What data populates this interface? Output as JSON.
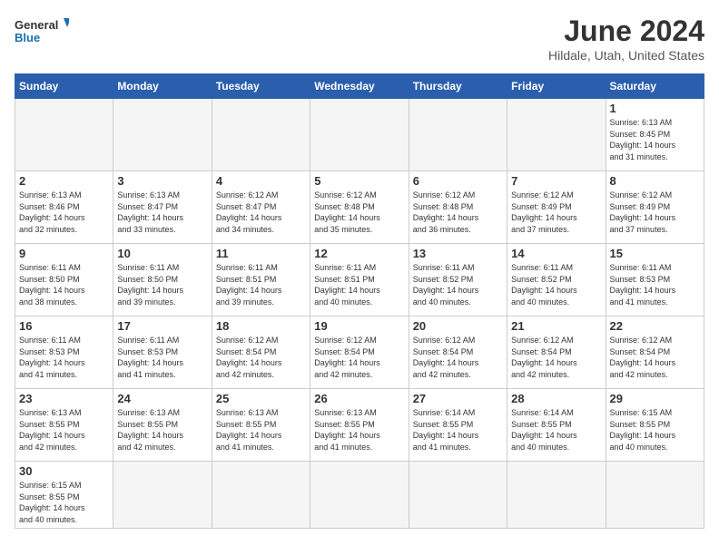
{
  "header": {
    "logo_general": "General",
    "logo_blue": "Blue",
    "month_title": "June 2024",
    "location": "Hildale, Utah, United States"
  },
  "days_of_week": [
    "Sunday",
    "Monday",
    "Tuesday",
    "Wednesday",
    "Thursday",
    "Friday",
    "Saturday"
  ],
  "weeks": [
    [
      {
        "day": "",
        "info": ""
      },
      {
        "day": "",
        "info": ""
      },
      {
        "day": "",
        "info": ""
      },
      {
        "day": "",
        "info": ""
      },
      {
        "day": "",
        "info": ""
      },
      {
        "day": "",
        "info": ""
      },
      {
        "day": "1",
        "info": "Sunrise: 6:13 AM\nSunset: 8:45 PM\nDaylight: 14 hours\nand 31 minutes."
      }
    ],
    [
      {
        "day": "2",
        "info": "Sunrise: 6:13 AM\nSunset: 8:46 PM\nDaylight: 14 hours\nand 32 minutes."
      },
      {
        "day": "3",
        "info": "Sunrise: 6:13 AM\nSunset: 8:47 PM\nDaylight: 14 hours\nand 33 minutes."
      },
      {
        "day": "4",
        "info": "Sunrise: 6:12 AM\nSunset: 8:47 PM\nDaylight: 14 hours\nand 34 minutes."
      },
      {
        "day": "5",
        "info": "Sunrise: 6:12 AM\nSunset: 8:48 PM\nDaylight: 14 hours\nand 35 minutes."
      },
      {
        "day": "6",
        "info": "Sunrise: 6:12 AM\nSunset: 8:48 PM\nDaylight: 14 hours\nand 36 minutes."
      },
      {
        "day": "7",
        "info": "Sunrise: 6:12 AM\nSunset: 8:49 PM\nDaylight: 14 hours\nand 37 minutes."
      },
      {
        "day": "8",
        "info": "Sunrise: 6:12 AM\nSunset: 8:49 PM\nDaylight: 14 hours\nand 37 minutes."
      }
    ],
    [
      {
        "day": "9",
        "info": "Sunrise: 6:11 AM\nSunset: 8:50 PM\nDaylight: 14 hours\nand 38 minutes."
      },
      {
        "day": "10",
        "info": "Sunrise: 6:11 AM\nSunset: 8:50 PM\nDaylight: 14 hours\nand 39 minutes."
      },
      {
        "day": "11",
        "info": "Sunrise: 6:11 AM\nSunset: 8:51 PM\nDaylight: 14 hours\nand 39 minutes."
      },
      {
        "day": "12",
        "info": "Sunrise: 6:11 AM\nSunset: 8:51 PM\nDaylight: 14 hours\nand 40 minutes."
      },
      {
        "day": "13",
        "info": "Sunrise: 6:11 AM\nSunset: 8:52 PM\nDaylight: 14 hours\nand 40 minutes."
      },
      {
        "day": "14",
        "info": "Sunrise: 6:11 AM\nSunset: 8:52 PM\nDaylight: 14 hours\nand 40 minutes."
      },
      {
        "day": "15",
        "info": "Sunrise: 6:11 AM\nSunset: 8:53 PM\nDaylight: 14 hours\nand 41 minutes."
      }
    ],
    [
      {
        "day": "16",
        "info": "Sunrise: 6:11 AM\nSunset: 8:53 PM\nDaylight: 14 hours\nand 41 minutes."
      },
      {
        "day": "17",
        "info": "Sunrise: 6:11 AM\nSunset: 8:53 PM\nDaylight: 14 hours\nand 41 minutes."
      },
      {
        "day": "18",
        "info": "Sunrise: 6:12 AM\nSunset: 8:54 PM\nDaylight: 14 hours\nand 42 minutes."
      },
      {
        "day": "19",
        "info": "Sunrise: 6:12 AM\nSunset: 8:54 PM\nDaylight: 14 hours\nand 42 minutes."
      },
      {
        "day": "20",
        "info": "Sunrise: 6:12 AM\nSunset: 8:54 PM\nDaylight: 14 hours\nand 42 minutes."
      },
      {
        "day": "21",
        "info": "Sunrise: 6:12 AM\nSunset: 8:54 PM\nDaylight: 14 hours\nand 42 minutes."
      },
      {
        "day": "22",
        "info": "Sunrise: 6:12 AM\nSunset: 8:54 PM\nDaylight: 14 hours\nand 42 minutes."
      }
    ],
    [
      {
        "day": "23",
        "info": "Sunrise: 6:13 AM\nSunset: 8:55 PM\nDaylight: 14 hours\nand 42 minutes."
      },
      {
        "day": "24",
        "info": "Sunrise: 6:13 AM\nSunset: 8:55 PM\nDaylight: 14 hours\nand 42 minutes."
      },
      {
        "day": "25",
        "info": "Sunrise: 6:13 AM\nSunset: 8:55 PM\nDaylight: 14 hours\nand 41 minutes."
      },
      {
        "day": "26",
        "info": "Sunrise: 6:13 AM\nSunset: 8:55 PM\nDaylight: 14 hours\nand 41 minutes."
      },
      {
        "day": "27",
        "info": "Sunrise: 6:14 AM\nSunset: 8:55 PM\nDaylight: 14 hours\nand 41 minutes."
      },
      {
        "day": "28",
        "info": "Sunrise: 6:14 AM\nSunset: 8:55 PM\nDaylight: 14 hours\nand 40 minutes."
      },
      {
        "day": "29",
        "info": "Sunrise: 6:15 AM\nSunset: 8:55 PM\nDaylight: 14 hours\nand 40 minutes."
      }
    ],
    [
      {
        "day": "30",
        "info": "Sunrise: 6:15 AM\nSunset: 8:55 PM\nDaylight: 14 hours\nand 40 minutes."
      },
      {
        "day": "",
        "info": ""
      },
      {
        "day": "",
        "info": ""
      },
      {
        "day": "",
        "info": ""
      },
      {
        "day": "",
        "info": ""
      },
      {
        "day": "",
        "info": ""
      },
      {
        "day": "",
        "info": ""
      }
    ]
  ]
}
